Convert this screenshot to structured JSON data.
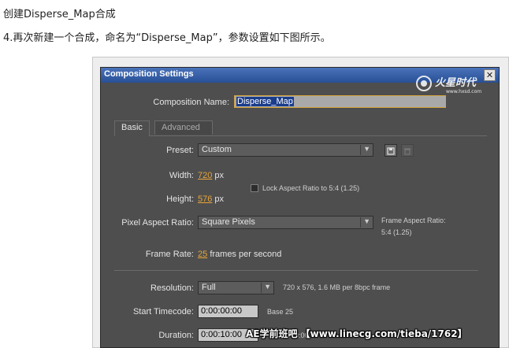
{
  "article": {
    "title": "创建Disperse_Map合成",
    "step": "4.再次新建一个合成，命名为“Disperse_Map”，参数设置如下图所示。"
  },
  "dialog": {
    "title": "Composition Settings",
    "close_glyph": "✕",
    "comp_name_label": "Composition Name:",
    "comp_name_value": "Disperse_Map",
    "tabs": [
      {
        "label": "Basic",
        "active": true
      },
      {
        "label": "Advanced",
        "active": false
      }
    ],
    "preset": {
      "label": "Preset:",
      "value": "Custom",
      "save_icon": "save-preset-icon",
      "delete_icon": "trash-icon"
    },
    "width": {
      "label": "Width:",
      "value": "720",
      "unit": "px"
    },
    "height": {
      "label": "Height:",
      "value": "576",
      "unit": "px"
    },
    "lock_aspect": {
      "label": "Lock Aspect Ratio to 5:4 (1.25)",
      "checked": false
    },
    "pixel_aspect": {
      "label": "Pixel Aspect Ratio:",
      "value": "Square Pixels"
    },
    "frame_aspect": {
      "label": "Frame Aspect Ratio:",
      "value": "5:4 (1.25)"
    },
    "frame_rate": {
      "label": "Frame Rate:",
      "value": "25",
      "unit": "frames per second"
    },
    "resolution": {
      "label": "Resolution:",
      "value": "Full",
      "info": "720 x 576, 1.6 MB per 8bpc frame"
    },
    "start_timecode": {
      "label": "Start Timecode:",
      "value": "0:00:00:00",
      "info": "Base 25"
    },
    "duration": {
      "label": "Duration:",
      "value": "0:00:10:00",
      "info": "0:00"
    }
  },
  "watermark": {
    "logo_text": "火星时代",
    "logo_url": "www.hxsd.com",
    "bottom_text": "AE学前班吧 【www.linecg.com/tieba/1762】"
  },
  "colors": {
    "accent_orange": "#e8a438",
    "title_bar": "#274f96",
    "dialog_bg": "#4e4e4e"
  }
}
